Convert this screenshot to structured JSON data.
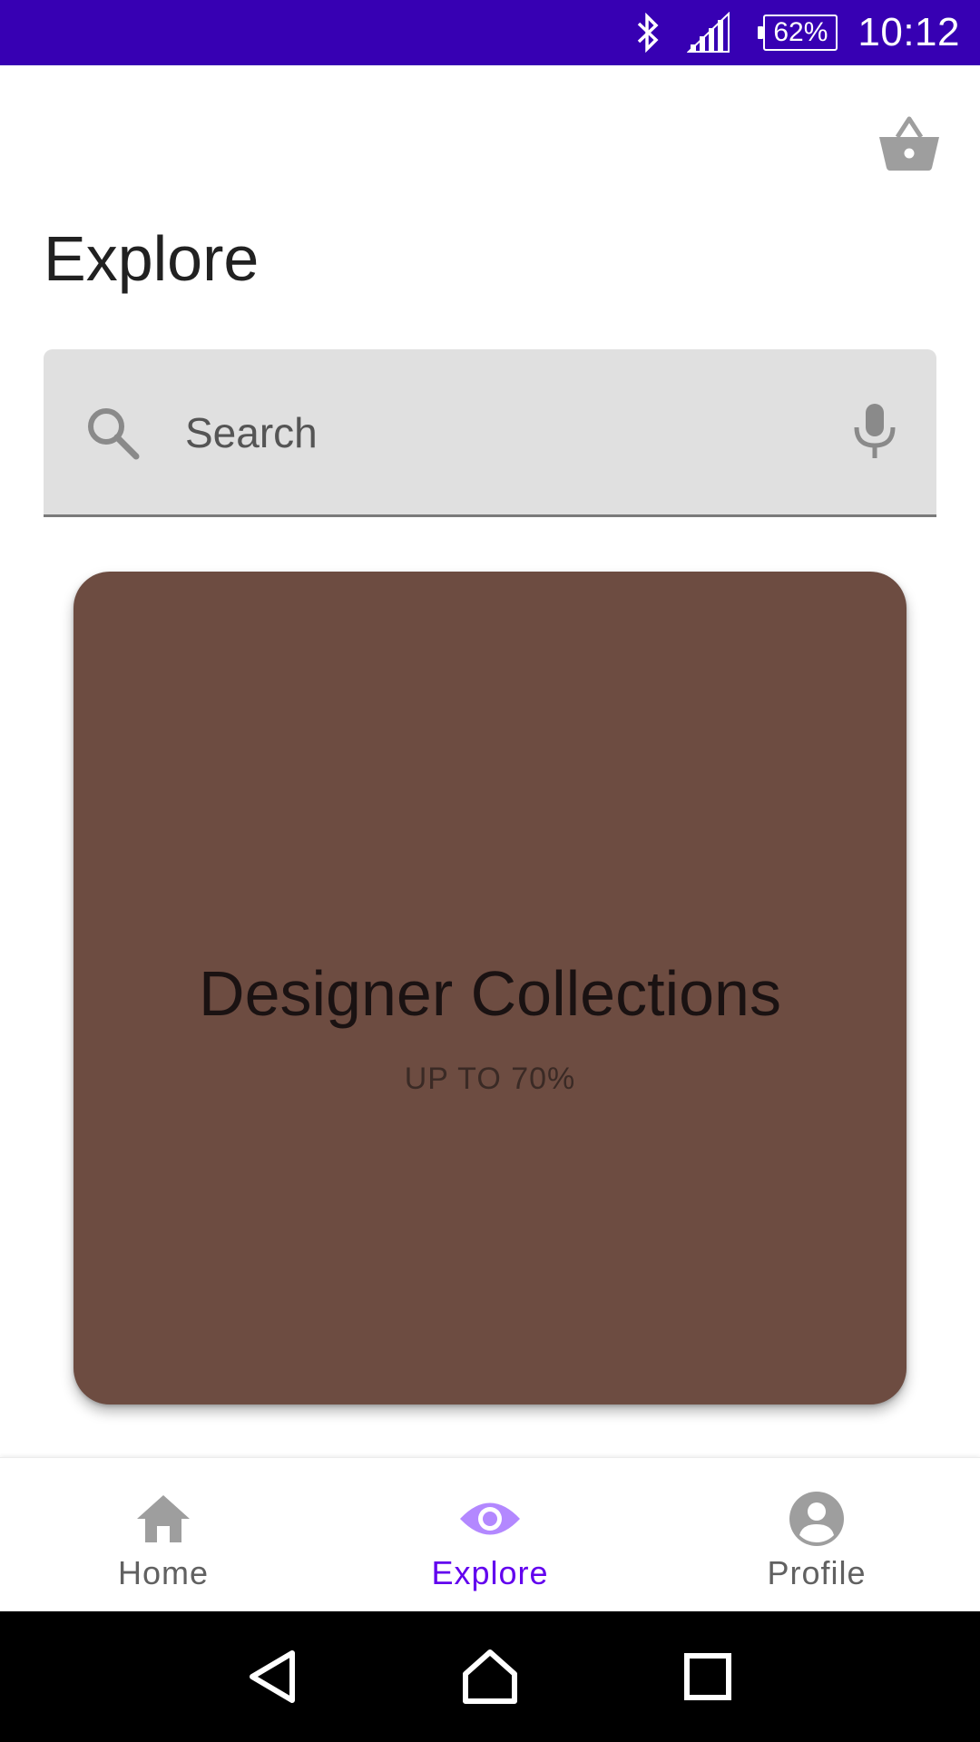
{
  "status_bar": {
    "battery": "62%",
    "time": "10:12",
    "icons": [
      "bluetooth-icon",
      "cell-signal-icon",
      "battery-icon"
    ]
  },
  "header": {
    "title": "Explore",
    "cart_icon": "shopping-basket-icon"
  },
  "search": {
    "placeholder": "Search",
    "leading_icon": "search-icon",
    "trailing_icon": "mic-icon"
  },
  "promo": {
    "title": "Designer Collections",
    "subtitle": "UP TO 70%",
    "background_color": "#6d4c41"
  },
  "bottom_nav": {
    "items": [
      {
        "label": "Home",
        "icon": "home-icon",
        "active": false
      },
      {
        "label": "Explore",
        "icon": "eye-icon",
        "active": true
      },
      {
        "label": "Profile",
        "icon": "account-circle-icon",
        "active": false
      }
    ],
    "active_color": "#6200ee",
    "active_icon_color": "#b388ff",
    "inactive_color": "#9e9e9e"
  },
  "system_nav": {
    "buttons": [
      "back-icon",
      "home-circle-icon",
      "recents-icon"
    ]
  },
  "colors": {
    "status_bar": "#3700b3",
    "search_background": "#e0e0e0"
  }
}
